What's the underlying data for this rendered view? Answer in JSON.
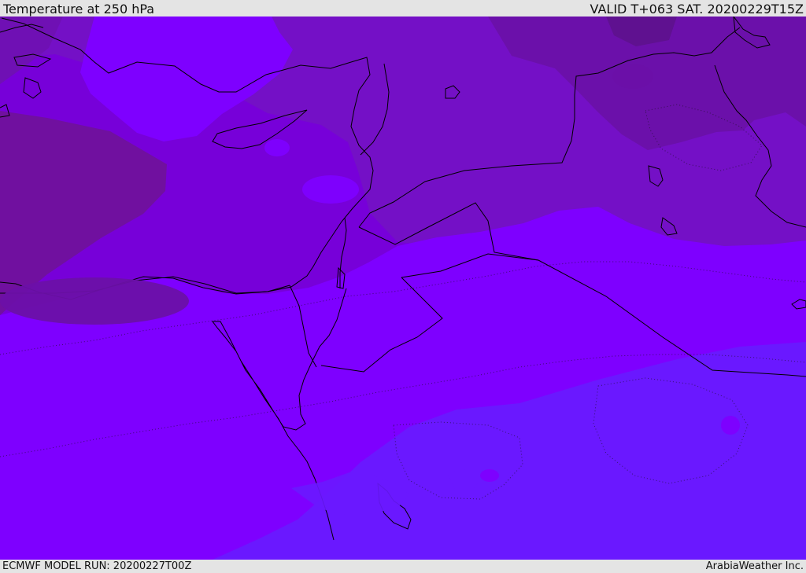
{
  "header": {
    "title": "Temperature at 250 hPa",
    "valid_time": "VALID T+063 SAT. 20200229T15Z"
  },
  "footer": {
    "model_run": "ECMWF MODEL RUN: 20200227T00Z",
    "credit": "ArabiaWeather Inc."
  },
  "map": {
    "colors": {
      "darkest": "#6a0f9c",
      "dark": "#7010b0",
      "mid": "#7a00e6",
      "bright": "#7e00ff",
      "blue": "#6a18ff",
      "border": "#000000"
    }
  }
}
